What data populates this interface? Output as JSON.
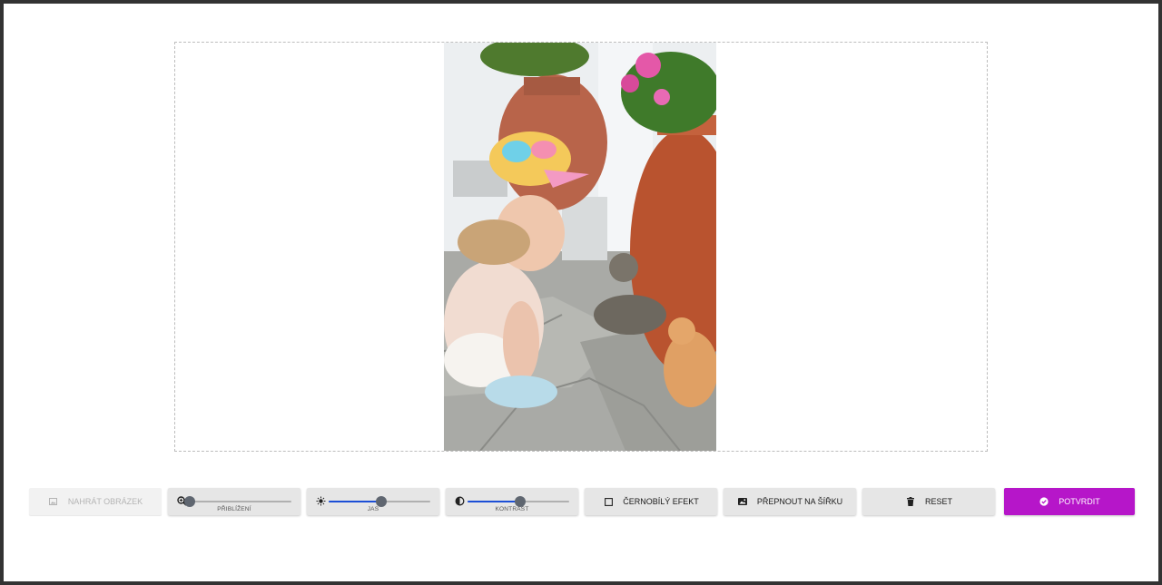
{
  "toolbar": {
    "upload": {
      "label": "Nahrát obrázek",
      "icon": "image-icon",
      "disabled": true
    },
    "zoom": {
      "label": "Přiblížení",
      "icon": "zoom-in-icon",
      "value": 0
    },
    "brightness": {
      "label": "Jas",
      "icon": "sun-icon",
      "value": 0.52
    },
    "contrast": {
      "label": "Kontrast",
      "icon": "contrast-icon",
      "value": 0.52
    },
    "grayscale": {
      "label": "Černobílý efekt",
      "icon": "checkbox-icon",
      "checked": false
    },
    "orientation": {
      "label": "Přepnout na šířku",
      "icon": "landscape-image-icon"
    },
    "reset": {
      "label": "Reset",
      "icon": "trash-icon"
    },
    "confirm": {
      "label": "Potvrdit",
      "icon": "check-circle-icon"
    }
  },
  "colors": {
    "primary": "#b616c9",
    "slider_fill": "#1c4fd6",
    "slider_thumb": "#5f6670",
    "button_bg": "#e6e6e6"
  }
}
